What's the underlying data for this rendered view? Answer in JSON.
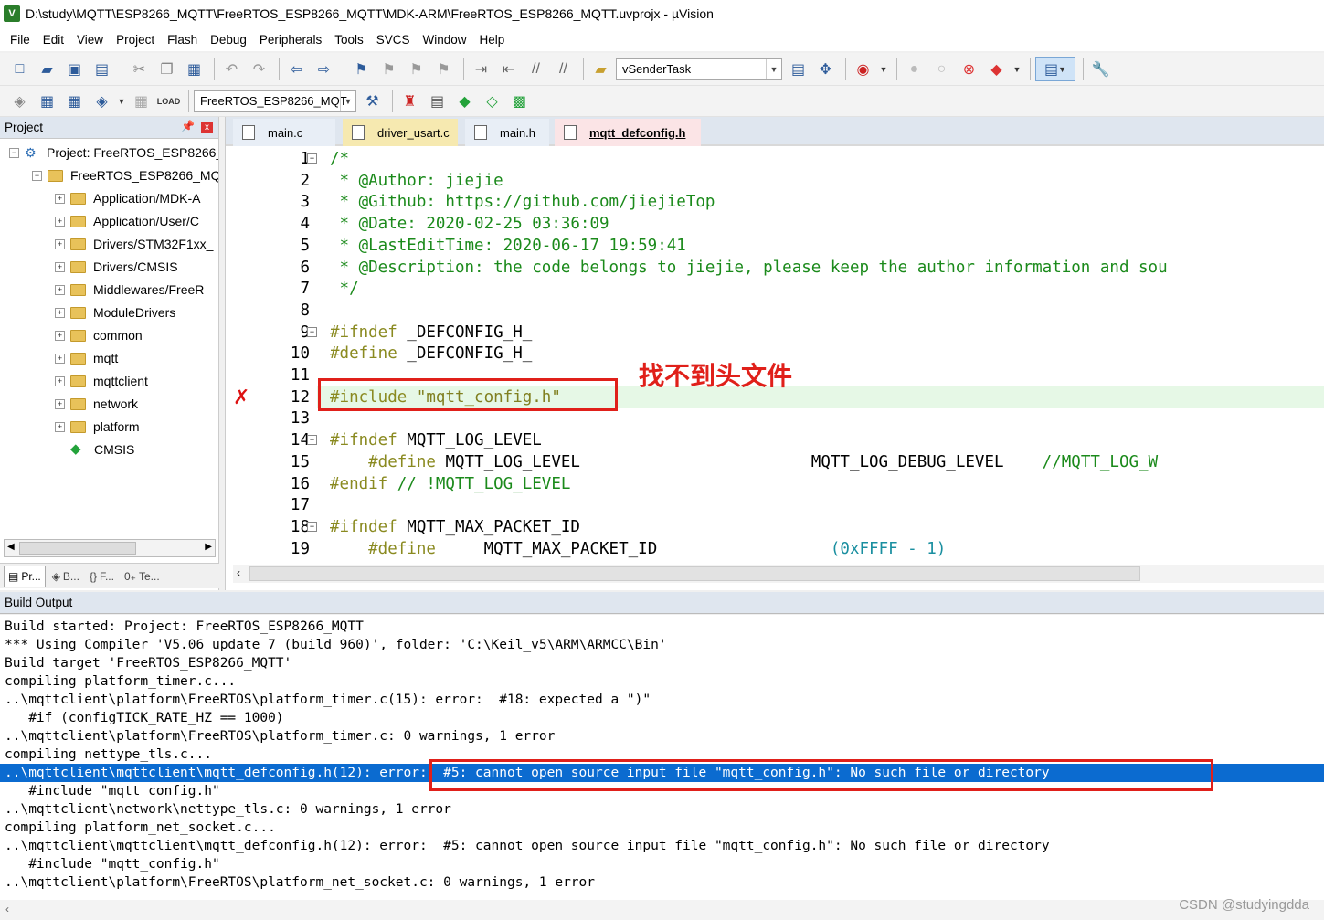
{
  "window": {
    "title": "D:\\study\\MQTT\\ESP8266_MQTT\\FreeRTOS_ESP8266_MQTT\\MDK-ARM\\FreeRTOS_ESP8266_MQTT.uvprojx - µVision",
    "icon_text": "V"
  },
  "menu": [
    "File",
    "Edit",
    "View",
    "Project",
    "Flash",
    "Debug",
    "Peripherals",
    "Tools",
    "SVCS",
    "Window",
    "Help"
  ],
  "toolbar": {
    "find_combo": "vSenderTask",
    "target_combo": "FreeRTOS_ESP8266_MQT",
    "load_label": "LOAD"
  },
  "project_panel": {
    "title": "Project",
    "pin": "ᴾ",
    "close": "x",
    "tree": [
      {
        "label": "Project: FreeRTOS_ESP8266_",
        "expander": "−"
      },
      {
        "label": "FreeRTOS_ESP8266_MQ",
        "expander": "−"
      },
      {
        "label": "Application/MDK-A",
        "expander": "+"
      },
      {
        "label": "Application/User/C",
        "expander": "+"
      },
      {
        "label": "Drivers/STM32F1xx_",
        "expander": "+"
      },
      {
        "label": "Drivers/CMSIS",
        "expander": "+"
      },
      {
        "label": "Middlewares/FreeR",
        "expander": "+"
      },
      {
        "label": "ModuleDrivers",
        "expander": "+"
      },
      {
        "label": "common",
        "expander": "+"
      },
      {
        "label": "mqtt",
        "expander": "+"
      },
      {
        "label": "mqttclient",
        "expander": "+"
      },
      {
        "label": "network",
        "expander": "+"
      },
      {
        "label": "platform",
        "expander": "+"
      },
      {
        "label": "CMSIS",
        "expander": ""
      }
    ],
    "tabs": [
      "Pr...",
      "B...",
      "F...",
      "Te..."
    ]
  },
  "editor": {
    "tabs": [
      "main.c",
      "driver_usart.c",
      "main.h",
      "mqtt_defconfig.h"
    ],
    "annotation": "找不到头文件",
    "lines": [
      {
        "n": "1",
        "text": "/*",
        "cls": "c-comment"
      },
      {
        "n": "2",
        "text": " * @Author: jiejie",
        "cls": "c-comment"
      },
      {
        "n": "3",
        "text": " * @Github: https://github.com/jiejieTop",
        "cls": "c-comment"
      },
      {
        "n": "4",
        "text": " * @Date: 2020-02-25 03:36:09",
        "cls": "c-comment"
      },
      {
        "n": "5",
        "text": " * @LastEditTime: 2020-06-17 19:59:41",
        "cls": "c-comment"
      },
      {
        "n": "6",
        "text": " * @Description: the code belongs to jiejie, please keep the author information and sou",
        "cls": "c-comment"
      },
      {
        "n": "7",
        "text": " */",
        "cls": "c-comment"
      },
      {
        "n": "8",
        "text": "",
        "cls": ""
      },
      {
        "n": "9",
        "pre": "#ifndef",
        "rest": " _DEFCONFIG_H_"
      },
      {
        "n": "10",
        "pre": "#define",
        "rest": " _DEFCONFIG_H_"
      },
      {
        "n": "11",
        "text": "",
        "cls": ""
      },
      {
        "n": "12",
        "pre": "#include",
        "str": " \"mqtt_config.h\""
      },
      {
        "n": "13",
        "text": "",
        "cls": ""
      },
      {
        "n": "14",
        "pre": "#ifndef",
        "rest": " MQTT_LOG_LEVEL"
      },
      {
        "n": "15",
        "pre": "    #define",
        "rest": " MQTT_LOG_LEVEL                        MQTT_LOG_DEBUG_LEVEL    ",
        "cmt": "//MQTT_LOG_W"
      },
      {
        "n": "16",
        "pre": "#endif",
        "cmt": " // !MQTT_LOG_LEVEL"
      },
      {
        "n": "17",
        "text": "",
        "cls": ""
      },
      {
        "n": "18",
        "pre": "#ifndef",
        "rest": " MQTT_MAX_PACKET_ID"
      },
      {
        "n": "19",
        "pre": "    #define",
        "rest": "     MQTT_MAX_PACKET_ID                  ",
        "num": "(0xFFFF - 1)"
      }
    ]
  },
  "build_output": {
    "title": "Build Output",
    "lines": [
      "Build started: Project: FreeRTOS_ESP8266_MQTT",
      "*** Using Compiler 'V5.06 update 7 (build 960)', folder: 'C:\\Keil_v5\\ARM\\ARMCC\\Bin'",
      "Build target 'FreeRTOS_ESP8266_MQTT'",
      "compiling platform_timer.c...",
      "..\\mqttclient\\platform\\FreeRTOS\\platform_timer.c(15): error:  #18: expected a \")\"",
      "   #if (configTICK_RATE_HZ == 1000)",
      "..\\mqttclient\\platform\\FreeRTOS\\platform_timer.c: 0 warnings, 1 error",
      "compiling nettype_tls.c...",
      "..\\mqttclient\\mqttclient\\mqtt_defconfig.h(12): error:  #5: cannot open source input file \"mqtt_config.h\": No such file or directory",
      "   #include \"mqtt_config.h\"",
      "..\\mqttclient\\network\\nettype_tls.c: 0 warnings, 1 error",
      "compiling platform_net_socket.c...",
      "..\\mqttclient\\mqttclient\\mqtt_defconfig.h(12): error:  #5: cannot open source input file \"mqtt_config.h\": No such file or directory",
      "   #include \"mqtt_config.h\"",
      "..\\mqttclient\\platform\\FreeRTOS\\platform_net_socket.c: 0 warnings, 1 error"
    ],
    "selected_index": 8
  },
  "watermark": "CSDN @studyingdda",
  "colors": {
    "comment": "#1b8a1b",
    "preprocessor": "#8a8a20",
    "highlight_line": "#e6f8e6",
    "selection": "#0b6bd0",
    "annotation": "#e0201a"
  }
}
